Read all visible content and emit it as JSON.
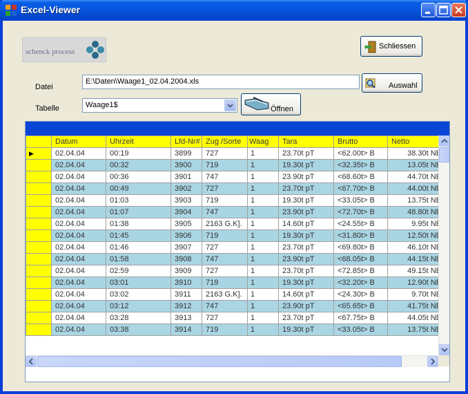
{
  "window": {
    "title": "Excel-Viewer"
  },
  "logo": {
    "text": "schenck process"
  },
  "buttons": {
    "close_label": "Schliessen",
    "select_label": "Auswahl",
    "open_label": "Öffnen"
  },
  "file": {
    "label": "Datei",
    "value": "E:\\Daten\\Waage1_02.04.2004.xls"
  },
  "table_select": {
    "label": "Tabelle",
    "value": "Waage1$"
  },
  "grid": {
    "columns": [
      "Datum",
      "Uhrzeit",
      "Lfd-Nr#",
      "Zug /Sorte",
      "Waag",
      "Tara",
      "Brutto",
      "Netto"
    ],
    "rows": [
      [
        "02.04.04",
        "00:19",
        "3899",
        "727",
        "1",
        "23.70t  pT",
        "<62.00t>  B",
        "38.30t NE"
      ],
      [
        "02.04.04",
        "00:32",
        "3900",
        "719",
        "1",
        "19.30t  pT",
        "<32.35t>  B",
        "13.05t NE"
      ],
      [
        "02.04.04",
        "00:36",
        "3901",
        "747",
        "1",
        "23.90t  pT",
        "<68.60t>  B",
        "44.70t NE"
      ],
      [
        "02.04.04",
        "00:49",
        "3902",
        "727",
        "1",
        "23.70t  pT",
        "<67.70t>  B",
        "44.00t NE"
      ],
      [
        "02.04.04",
        "01:03",
        "3903",
        "719",
        "1",
        "19.30t  pT",
        "<33.05t>  B",
        "13.75t NE"
      ],
      [
        "02.04.04",
        "01:07",
        "3904",
        "747",
        "1",
        "23.90t  pT",
        "<72.70t>  B",
        "48.80t NE"
      ],
      [
        "02.04.04",
        "01:38",
        "3905",
        "2163 G.K].",
        "1",
        "14.60t  pT",
        "<24.55t>  B",
        "9.95t NE"
      ],
      [
        "02.04.04",
        "01:45",
        "3906",
        "719",
        "1",
        "19.30t  pT",
        "<31.80t>  B",
        "12.50t NE"
      ],
      [
        "02.04.04",
        "01:46",
        "3907",
        "727",
        "1",
        "23.70t  pT",
        "<69.80t>  B",
        "46.10t NE"
      ],
      [
        "02.04.04",
        "01:58",
        "3908",
        "747",
        "1",
        "23.90t  pT",
        "<68.05t>  B",
        "44.15t NE"
      ],
      [
        "02.04.04",
        "02:59",
        "3909",
        "727",
        "1",
        "23.70t  pT",
        "<72.85t>  B",
        "49.15t NE"
      ],
      [
        "02.04.04",
        "03:01",
        "3910",
        "719",
        "1",
        "19.30t  pT",
        "<32.20t>  B",
        "12.90t NE"
      ],
      [
        "02.04.04",
        "03:02",
        "3911",
        "2163 G.K].",
        "1",
        "14.60t  pT",
        "<24.30t>  B",
        "9.70t NE"
      ],
      [
        "02.04.04",
        "03:12",
        "3912",
        "747",
        "1",
        "23.90t  pT",
        "<65.65t>  B",
        "41.75t NE"
      ],
      [
        "02.04.04",
        "03:28",
        "3913",
        "727",
        "1",
        "23.70t  pT",
        "<67.75t>  B",
        "44.05t NE"
      ],
      [
        "02.04.04",
        "03:38",
        "3914",
        "719",
        "1",
        "19.30t  pT",
        "<33.05t>  B",
        "13.75t NE"
      ]
    ],
    "current_row_marker": "▶"
  },
  "colors": {
    "titlebar": "#0553de",
    "caption": "#0a44d6",
    "header": "#ffff00",
    "alt_row": "#aad5e3"
  }
}
